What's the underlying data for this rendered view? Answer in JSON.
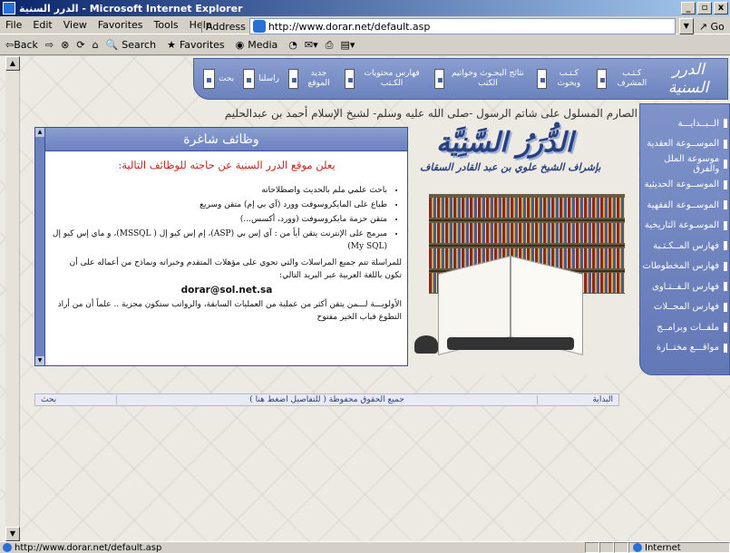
{
  "window": {
    "title": "الدرر السنية - Microsoft Internet Explorer",
    "controls": [
      "_",
      "▫",
      "x"
    ]
  },
  "menu": [
    "File",
    "Edit",
    "View",
    "Favorites",
    "Tools",
    "Help"
  ],
  "address": {
    "label": "Address",
    "url": "http://www.dorar.net/default.asp",
    "go": "Go"
  },
  "toolbar": {
    "back": "⇦Back",
    "forward": "⇨",
    "stop": "⊗",
    "refresh": "⟳",
    "home": "⌂",
    "search": "Search",
    "favorites": "Favorites",
    "media": "Media",
    "history": "◔"
  },
  "site": {
    "brand": "الدرر السنية",
    "top_nav": [
      {
        "label": "كـتـب المشرف"
      },
      {
        "label": "كـتـب وبحوث"
      },
      {
        "label": "نتائج البحـوث وخواتيم الكتب"
      },
      {
        "label": "فهارس محتويات الكـتب"
      },
      {
        "label": "جديد الموقع"
      },
      {
        "label": "راسلنا"
      },
      {
        "label": "بحث"
      }
    ],
    "header_line": "الصارم المسلول على شاتم الرسول -صلى الله عليه وسلم- لشيخ الإسلام أحمد بن عبدالحليم",
    "side_nav": [
      "الــبــدايـــة",
      "الموســوعة العقدية",
      "موسوعة الملل والفرق",
      "الموســوعة الحديثية",
      "الموســوعة الفقهية",
      "الموسـوعة التاريخية",
      "فهارس المــكـتـبة",
      "فهارس المخطوطات",
      "فهارس الـفــتـاوى",
      "فهارس المجــلات",
      "ملفــات وبرامــج",
      "مواقـــع مختــارة"
    ],
    "logo_title": "الدُّرَرُ السَّنِيَّة",
    "logo_subtitle": "بإشراف الشيخ علوي بن عبد القادر السقاف",
    "panel": {
      "title": "وظائف شاغرة",
      "subtitle": "يعلن موقع الدرر السنية عن حاجته للوظائف التالية:",
      "jobs": [
        "باحث علمي ملم بالحديث واصطلاحاته",
        "طباع على المايكروسوفت وورد (آي بي إم) متقن وسريع",
        "متقن حزمة مايكروسوفت (وورد، أكسس...)",
        "مبرمج على الإنترنت يتقن أياً من : آي إس بي (ASP)، إم إس كيو إل ( MSSQL)، و ماي إس كيو إل (My SQL)"
      ],
      "contact_text": "للمراسلة تتم جميع المراسلات والتي تحوي على مؤهلات المتقدم وخبراته ونماذج من أعماله على أن تكون باللغة العربية عبر البريد التالي:",
      "email": "dorar@sol.net.sa",
      "note": "الأولويـــة لـــمن يتقن أكثر من عملية من العمليات السابقة، والرواتب ستكون مجزية .. علماً أن من أراد التطوع فباب الخير مفتوح"
    },
    "footer": {
      "start": "البداية",
      "rights": "جميع الحقوق محفوظة ( للتفاصيل اضغط هنا )",
      "search": "بحث"
    }
  },
  "status": {
    "url": "http://www.dorar.net/default.asp",
    "zone": "Internet"
  }
}
